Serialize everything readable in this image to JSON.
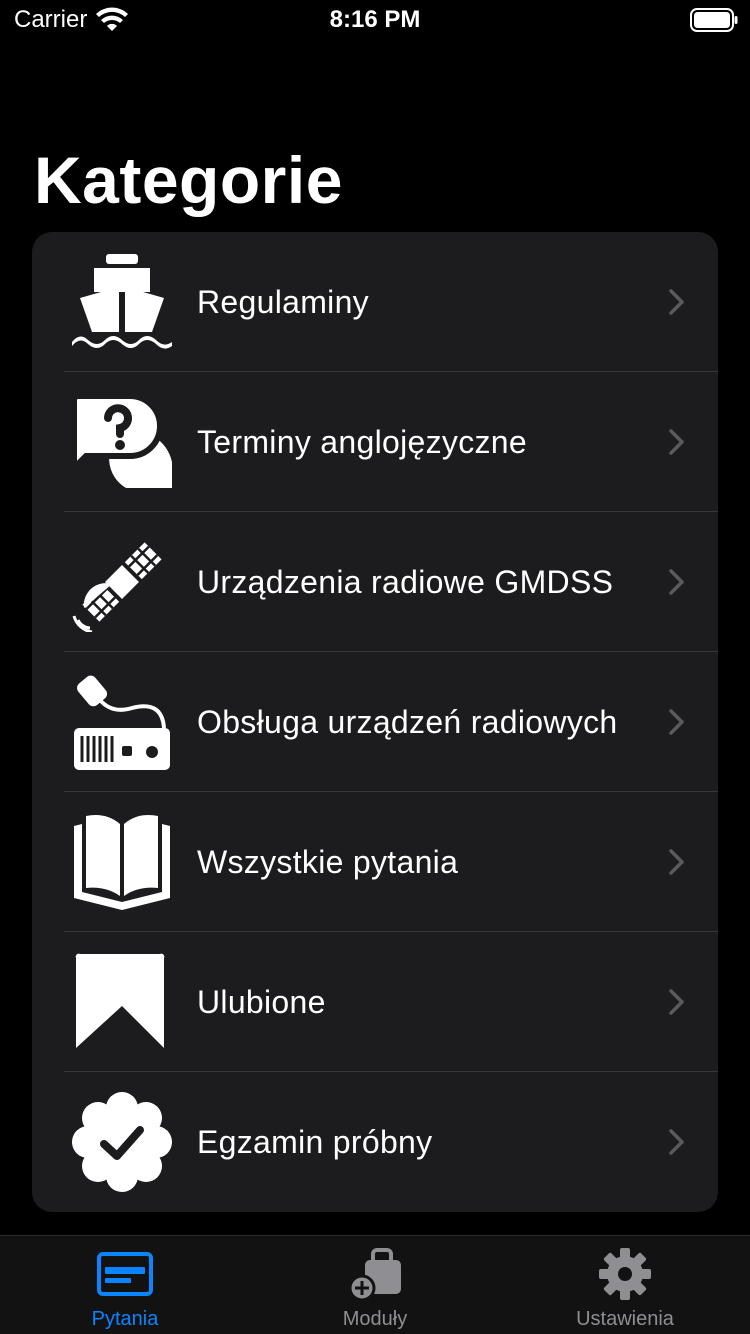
{
  "status_bar": {
    "carrier": "Carrier",
    "time": "8:16 PM"
  },
  "page": {
    "title": "Kategorie"
  },
  "categories": [
    {
      "label": "Regulaminy",
      "icon": "ship-icon"
    },
    {
      "label": "Terminy anglojęzyczne",
      "icon": "question-bubble-icon"
    },
    {
      "label": "Urządzenia radiowe GMDSS",
      "icon": "satellite-icon"
    },
    {
      "label": "Obsługa urządzeń radiowych",
      "icon": "radio-icon"
    },
    {
      "label": "Wszystkie pytania",
      "icon": "book-icon"
    },
    {
      "label": "Ulubione",
      "icon": "bookmark-icon"
    },
    {
      "label": "Egzamin próbny",
      "icon": "badge-check-icon"
    }
  ],
  "tabs": [
    {
      "label": "Pytania",
      "icon": "questions-tab-icon",
      "active": true
    },
    {
      "label": "Moduły",
      "icon": "modules-tab-icon",
      "active": false
    },
    {
      "label": "Ustawienia",
      "icon": "gear-icon",
      "active": false
    }
  ],
  "colors": {
    "background": "#000000",
    "card": "#1c1c1e",
    "accent": "#0a84ff",
    "inactive": "#8e8e93",
    "chevron": "#5a5a5e"
  }
}
